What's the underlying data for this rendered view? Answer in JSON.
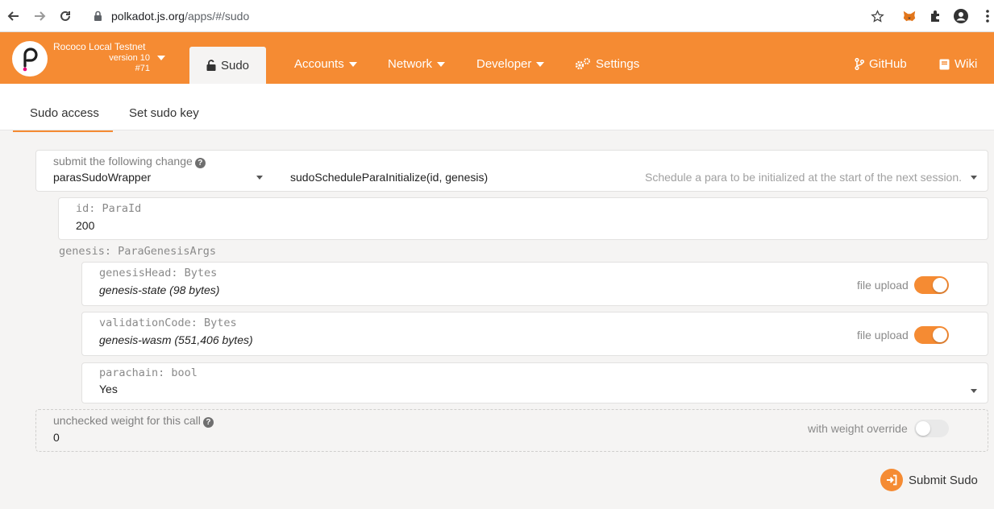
{
  "browser": {
    "url_domain": "polkadot.js.org",
    "url_path": "/apps/#/sudo"
  },
  "header": {
    "chain_name": "Rococo Local Testnet",
    "version": "version 10",
    "block": "#71",
    "active_tab": "Sudo",
    "menu": [
      "Accounts",
      "Network",
      "Developer",
      "Settings"
    ],
    "links": [
      "GitHub",
      "Wiki"
    ],
    "accent_color": "#f58b33"
  },
  "subtabs": [
    "Sudo access",
    "Set sudo key"
  ],
  "form": {
    "submit_label": "submit the following change",
    "section": "parasSudoWrapper",
    "method": "sudoScheduleParaInitialize(id, genesis)",
    "method_description": "Schedule a para to be initialized at the start of the next session.",
    "id_label": "id: ParaId",
    "id_value": "200",
    "genesis_label": "genesis: ParaGenesisArgs",
    "genesis_head_label": "genesisHead: Bytes",
    "genesis_head_value": "genesis-state (98 bytes)",
    "validation_code_label": "validationCode: Bytes",
    "validation_code_value": "genesis-wasm (551,406 bytes)",
    "file_upload_label": "file upload",
    "parachain_label": "parachain: bool",
    "parachain_value": "Yes",
    "weight_label": "unchecked weight for this call",
    "weight_value": "0",
    "weight_override_label": "with weight override",
    "submit_button": "Submit Sudo"
  }
}
